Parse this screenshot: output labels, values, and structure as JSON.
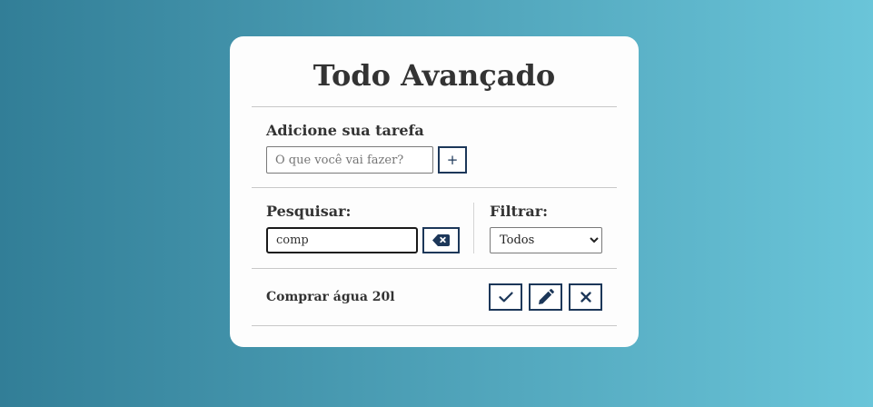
{
  "app": {
    "title": "Todo Avançado"
  },
  "add_section": {
    "label": "Adicione sua tarefa",
    "input_placeholder": "O que você vai fazer?",
    "input_value": "",
    "add_button_label": "+"
  },
  "search": {
    "label": "Pesquisar:",
    "value": "comp",
    "clear_icon": "backspace-icon"
  },
  "filter": {
    "label": "Filtrar:",
    "selected": "Todos",
    "options": [
      "Todos"
    ]
  },
  "todos": [
    {
      "text": "Comprar água 20l",
      "done_icon": "check-icon",
      "edit_icon": "pencil-icon",
      "remove_icon": "close-icon"
    }
  ],
  "colors": {
    "accent": "#1c3759",
    "background_start": "#327e97",
    "background_end": "#6ac5d9",
    "card": "#fdfdfd"
  }
}
